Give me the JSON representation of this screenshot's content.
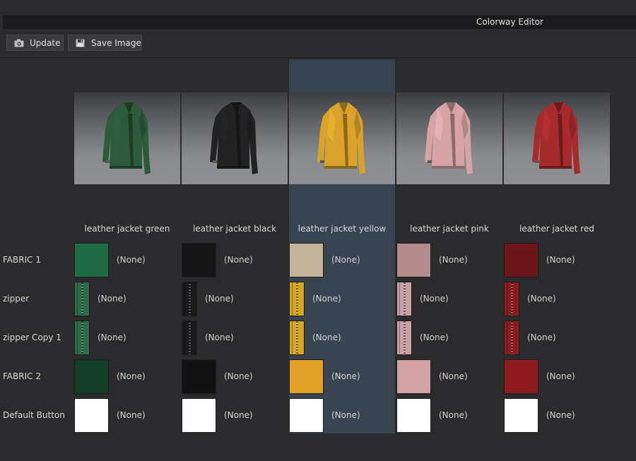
{
  "window": {
    "title": "Colorway Editor"
  },
  "toolbar": {
    "update_label": "Update",
    "update_icon": "camera-icon",
    "save_label": "Save Image",
    "save_icon": "floppy-disk-icon"
  },
  "selected_colorway": "leather jacket yellow",
  "colorways": [
    {
      "name": "leather jacket green",
      "jacket_color": "#2c5a3a",
      "swatches": [
        "#1f6b46",
        "#2d6b4a",
        "#2d6b4a",
        "#123d27",
        "#ffffff"
      ]
    },
    {
      "name": "leather jacket black",
      "jacket_color": "#222222",
      "swatches": [
        "#151515",
        "#1a1a1a",
        "#1a1a1a",
        "#121212",
        "#ffffff"
      ]
    },
    {
      "name": "leather jacket yellow",
      "jacket_color": "#d9a22a",
      "swatches": [
        "#c0b49a",
        "#d6a521",
        "#d6a521",
        "#e0a126",
        "#ffffff"
      ]
    },
    {
      "name": "leather jacket pink",
      "jacket_color": "#d6a4a6",
      "swatches": [
        "#b38d8d",
        "#c9a0a3",
        "#c9a0a3",
        "#cfa2a4",
        "#ffffff"
      ]
    },
    {
      "name": "leather jacket red",
      "jacket_color": "#a72a2c",
      "swatches": [
        "#6e1519",
        "#8d1c1f",
        "#8d1c1f",
        "#8e1b1d",
        "#ffffff"
      ]
    }
  ],
  "rows": [
    {
      "label": "FABRIC 1",
      "type": "fabric"
    },
    {
      "label": "zipper",
      "type": "zipper"
    },
    {
      "label": "zipper Copy 1",
      "type": "zipper"
    },
    {
      "label": "FABRIC 2",
      "type": "fabric"
    },
    {
      "label": "Default Button",
      "type": "fabric"
    }
  ],
  "material_value": "(None)"
}
